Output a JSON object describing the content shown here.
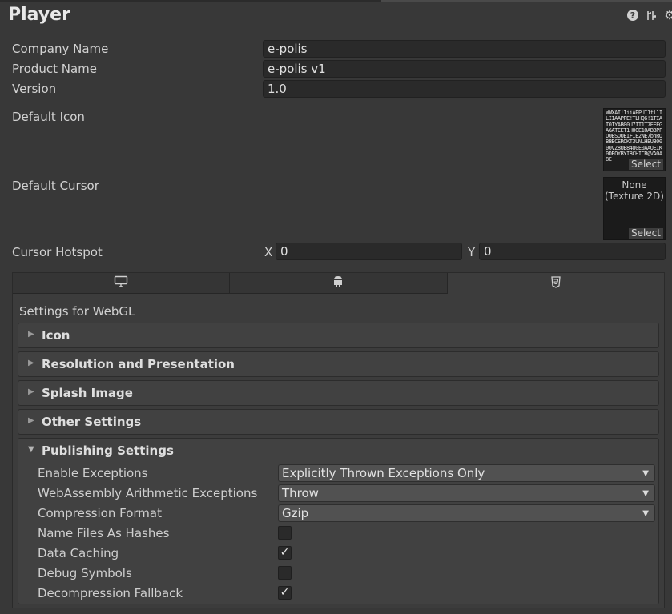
{
  "header": {
    "title": "Player",
    "icons": [
      "help-icon",
      "preset-icon",
      "gear-icon"
    ]
  },
  "fields": {
    "company_name": {
      "label": "Company Name",
      "value": "e-polis"
    },
    "product_name": {
      "label": "Product Name",
      "value": "e-polis v1"
    },
    "version": {
      "label": "Version",
      "value": "1.0"
    }
  },
  "default_icon": {
    "label": "Default Icon",
    "select": "Select"
  },
  "default_cursor": {
    "label": "Default Cursor",
    "none_line1": "None",
    "none_line2": "(Texture 2D)",
    "select": "Select"
  },
  "cursor_hotspot": {
    "label": "Cursor Hotspot",
    "x_label": "X",
    "x_value": "0",
    "y_label": "Y",
    "y_value": "0"
  },
  "platform_tabs": [
    {
      "icon": "monitor-icon",
      "active": false
    },
    {
      "icon": "android-icon",
      "active": false
    },
    {
      "icon": "html5-icon",
      "active": true
    }
  ],
  "settings_for": "Settings for WebGL",
  "sections": {
    "icon": "Icon",
    "resolution": "Resolution and Presentation",
    "splash": "Splash Image",
    "other": "Other Settings",
    "publishing": "Publishing Settings"
  },
  "publishing": {
    "enable_exceptions": {
      "label": "Enable Exceptions",
      "value": "Explicitly Thrown Exceptions Only"
    },
    "wasm_arith": {
      "label": "WebAssembly Arithmetic Exceptions",
      "value": "Throw"
    },
    "compression": {
      "label": "Compression Format",
      "value": "Gzip"
    },
    "name_files_hashes": {
      "label": "Name Files As Hashes",
      "checked": false
    },
    "data_caching": {
      "label": "Data Caching",
      "checked": true
    },
    "debug_symbols": {
      "label": "Debug Symbols",
      "checked": false
    },
    "decompression_fallback": {
      "label": "Decompression Fallback",
      "checked": true
    }
  },
  "colors": {
    "background": "#383838",
    "field": "#2a2a2a",
    "foldout": "#414141"
  }
}
